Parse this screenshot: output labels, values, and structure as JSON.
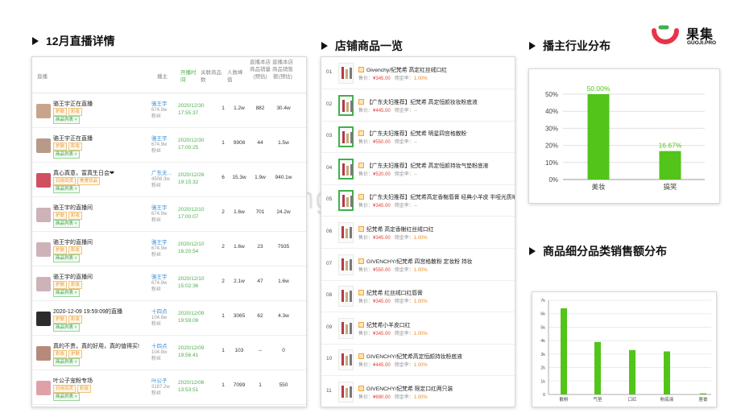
{
  "sections": {
    "live_title": "12月直播详情",
    "products_title": "店铺商品一览",
    "industry_title": "播主行业分布",
    "sales_title": "商品细分品类销售额分布"
  },
  "logo": {
    "cn": "果集",
    "en": "GUOJI.PRO"
  },
  "watermark": "www.bang008.com",
  "live_table": {
    "headers": {
      "live": "直播",
      "anchor": "播主",
      "start": "开播时间",
      "goods": "关联商品数",
      "viewers": "人数峰值",
      "sales": "直播本店商品销量(预估)",
      "amount": "直播本店商品销售额(预估)"
    },
    "rows": [
      {
        "title": "骆王宇正在直播",
        "tags": [
          "护肤",
          "彩妆"
        ],
        "goods_label": "商品列表",
        "anchor": "骆王宇",
        "fans": "674.9w",
        "fans_unit": "粉丝",
        "date": "2020/12/30",
        "time": "17:55:37",
        "goods": "1",
        "viewers": "1.2w",
        "sales": "882",
        "amount": "30.4w"
      },
      {
        "title": "骆王宇正在直播",
        "tags": [
          "护肤",
          "彩妆"
        ],
        "goods_label": "商品列表",
        "anchor": "骆王宇",
        "fans": "674.9w",
        "fans_unit": "粉丝",
        "date": "2020/12/30",
        "time": "17:00:25",
        "goods": "1",
        "viewers": "9908",
        "sales": "44",
        "amount": "1.5w"
      },
      {
        "title": "真心真意，富真生日会❤",
        "tags": [
          "日用百货",
          "美食饮品"
        ],
        "goods_label": "商品列表",
        "anchor": "广东夫…",
        "fans": "4508.3w",
        "fans_unit": "粉丝",
        "date": "2020/12/26",
        "time": "19:15:32",
        "goods": "6",
        "viewers": "15.3w",
        "sales": "1.9w",
        "amount": "940.1w"
      },
      {
        "title": "骆王宇的直播间",
        "tags": [
          "护肤",
          "彩妆"
        ],
        "goods_label": "商品列表",
        "anchor": "骆王宇",
        "fans": "674.9w",
        "fans_unit": "粉丝",
        "date": "2020/12/10",
        "time": "17:00:07",
        "goods": "2",
        "viewers": "1.6w",
        "sales": "701",
        "amount": "24.2w"
      },
      {
        "title": "骆王宇的直播间",
        "tags": [
          "护肤",
          "彩妆"
        ],
        "goods_label": "商品列表",
        "anchor": "骆王宇",
        "fans": "674.9w",
        "fans_unit": "粉丝",
        "date": "2020/12/10",
        "time": "16:20:54",
        "goods": "2",
        "viewers": "1.6w",
        "sales": "23",
        "amount": "7935"
      },
      {
        "title": "骆王宇的直播间",
        "tags": [
          "护肤",
          "彩妆"
        ],
        "goods_label": "商品列表",
        "anchor": "骆王宇",
        "fans": "674.9w",
        "fans_unit": "粉丝",
        "date": "2020/12/10",
        "time": "15:02:36",
        "goods": "2",
        "viewers": "2.1w",
        "sales": "47",
        "amount": "1.6w"
      },
      {
        "title": "2020-12-09 19:59:09的直播",
        "tags": [
          "护肤",
          "彩妆"
        ],
        "goods_label": "商品列表",
        "anchor": "十四点",
        "fans": "104.8w",
        "fans_unit": "粉丝",
        "date": "2020/12/09",
        "time": "19:59:09",
        "goods": "1",
        "viewers": "3065",
        "sales": "62",
        "amount": "4.3w"
      },
      {
        "title": "真的不贵，真的好用，真的值得买!",
        "tags": [
          "彩妆",
          "护肤"
        ],
        "goods_label": "商品列表",
        "anchor": "十四点",
        "fans": "104.8w",
        "fans_unit": "粉丝",
        "date": "2020/12/09",
        "time": "19:56:41",
        "goods": "1",
        "viewers": "103",
        "sales": "--",
        "amount": "0"
      },
      {
        "title": "叶公子宠粉专场",
        "tags": [
          "日用百货",
          "彩妆"
        ],
        "goods_label": "商品列表",
        "anchor": "叶公子",
        "fans": "3187.2w",
        "fans_unit": "粉丝",
        "date": "2020/12/06",
        "time": "13:53:51",
        "goods": "1",
        "viewers": "7099",
        "sales": "1",
        "amount": "550"
      }
    ]
  },
  "products": {
    "price_label": "售价：",
    "sales_label": "佣金率：",
    "items": [
      {
        "idx": "01",
        "name": "Givenchy/纪梵希 高定红丝绒口红",
        "price": "¥345.00",
        "commission": "1.00%",
        "highlight": false
      },
      {
        "idx": "02",
        "name": "【广东夫妇推荐】纪梵希 高定恒颜妆妆粉底液",
        "price": "¥445.00",
        "commission": "--",
        "highlight": true
      },
      {
        "idx": "03",
        "name": "【广东夫妇推荐】纪梵希 明星四宫格散粉",
        "price": "¥550.00",
        "commission": "--",
        "highlight": true
      },
      {
        "idx": "04",
        "name": "【广东夫妇推荐】纪梵希 高定恒颜持妆气垫粉底液",
        "price": "¥520.00",
        "commission": "--",
        "highlight": true
      },
      {
        "idx": "05",
        "name": "【广东夫妇推荐】纪梵希高定香榭唇膏 经典小羊皮 半哑光质地",
        "price": "¥345.00",
        "commission": "--",
        "highlight": true
      },
      {
        "idx": "06",
        "name": "纪梵希 高定香榭红丝绒口红",
        "price": "¥345.00",
        "commission": "1.00%",
        "highlight": false
      },
      {
        "idx": "07",
        "name": "GIVENCHY/纪梵希 四宫格散粉 定妆粉 持妆",
        "price": "¥550.00",
        "commission": "1.00%",
        "highlight": false
      },
      {
        "idx": "08",
        "name": "纪梵希 红丝绒口红唇膏",
        "price": "¥345.00",
        "commission": "1.00%",
        "highlight": false
      },
      {
        "idx": "09",
        "name": "纪梵希小羊皮口红",
        "price": "¥345.00",
        "commission": "1.00%",
        "highlight": false
      },
      {
        "idx": "10",
        "name": "GIVENCHY/纪梵希高定恒颜持妆粉底液",
        "price": "¥445.00",
        "commission": "1.00%",
        "highlight": false
      },
      {
        "idx": "11",
        "name": "GIVENCHY/纪梵希 限定口红两只装",
        "price": "¥690.00",
        "commission": "1.00%",
        "highlight": false
      }
    ]
  },
  "chart_data": [
    {
      "type": "bar",
      "title": "",
      "categories": [
        "美妆",
        "搞笑"
      ],
      "values": [
        50.0,
        16.67
      ],
      "data_labels": [
        "50.00%",
        "16.67%"
      ],
      "ylim": [
        0,
        50
      ],
      "y_ticks": [
        "0%",
        "10%",
        "20%",
        "30%",
        "40%",
        "50%"
      ],
      "grid": true,
      "color": "#52c41a"
    },
    {
      "type": "bar",
      "title": "",
      "categories": [
        "散粉",
        "气垫",
        "口红",
        "粉底液",
        "唇膏"
      ],
      "values": [
        6400,
        3900,
        3300,
        3200,
        80
      ],
      "ylim": [
        0,
        7000
      ],
      "y_ticks": [
        "0",
        "1k",
        "2k",
        "3k",
        "4k",
        "5k",
        "6k",
        "7k"
      ],
      "grid": true,
      "color": "#52c41a"
    }
  ]
}
